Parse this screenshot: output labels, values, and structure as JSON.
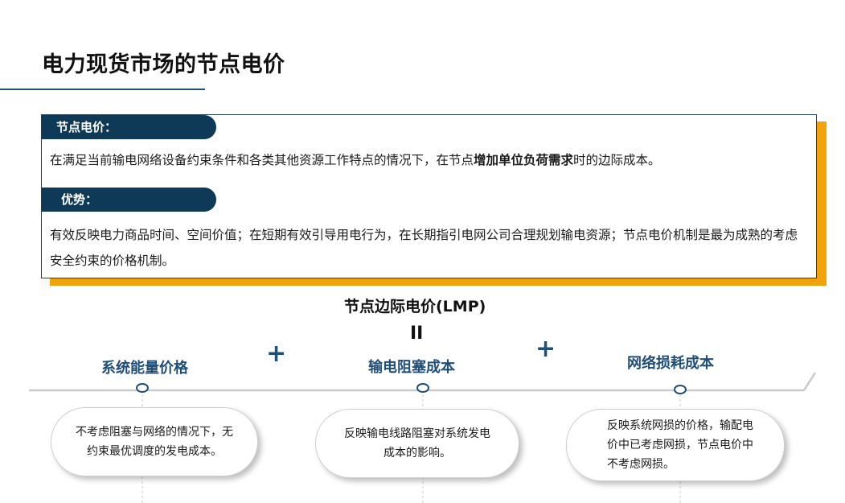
{
  "title": "电力现货市场的节点电价",
  "card": {
    "label1": "节点电价：",
    "def_prefix": "在满足当前输电网络设备约束条件和各类其他资源工作特点的情况下，在节点",
    "def_bold": "增加单位负荷需求",
    "def_suffix": "时的边际成本。",
    "label2": "优势：",
    "advantage": "有效反映电力商品时间、空间价值；在短期有效引导用电行为，在长期指引电网公司合理规划输电资源；节点电价机制是最为成熟的考虑安全约束的价格机制。"
  },
  "formula": {
    "lmp": "节点边际电价(LMP)",
    "equals": "II",
    "plus1": "+",
    "plus2": "+",
    "components": [
      {
        "name": "系统能量价格",
        "desc": "不考虑阻塞与网络的情况下，无约束最优调度的发电成本。"
      },
      {
        "name": "输电阻塞成本",
        "desc": "反映输电线路阻塞对系统发电成本的影响。"
      },
      {
        "name": "网络损耗成本",
        "desc": "反映系统网损的价格，输配电价中已考虑网损，节点电价中不考虑网损。"
      }
    ]
  },
  "colors": {
    "navy": "#0f3a57",
    "accent": "#f0a30a",
    "blue": "#1f4e79"
  }
}
